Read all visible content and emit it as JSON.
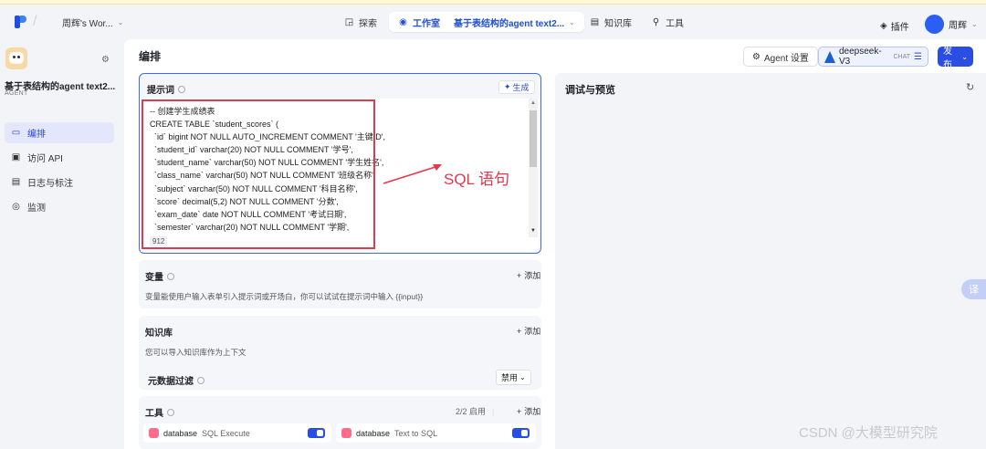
{
  "topbar": {
    "workspace": "周辉's Wor...",
    "nav": [
      {
        "icon": "compass-icon",
        "label": "探索"
      },
      {
        "icon": "robot-icon",
        "label": "工作室",
        "project": "基于表结构的agent text2..."
      },
      {
        "icon": "book-icon",
        "label": "知识库"
      },
      {
        "icon": "wrench-icon",
        "label": "工具"
      }
    ],
    "plugin": "插件",
    "user": "周辉"
  },
  "sidebar": {
    "bot_name": "基于表结构的agent text2...",
    "bot_type": "AGENT",
    "menu": [
      {
        "label": "编排",
        "icon": "layout-icon",
        "active": true
      },
      {
        "label": "访问 API",
        "icon": "terminal-icon"
      },
      {
        "label": "日志与标注",
        "icon": "log-icon"
      },
      {
        "label": "监测",
        "icon": "monitor-icon"
      }
    ]
  },
  "main": {
    "title": "编排",
    "agent_settings": "Agent 设置",
    "model": "deepseek-V3",
    "model_tag": "CHAT",
    "publish": "发布"
  },
  "prompt": {
    "label": "提示词",
    "generate": "生成",
    "lines": [
      "-- 创建学生成绩表",
      "CREATE TABLE `student_scores` (",
      "  `id` bigint NOT NULL AUTO_INCREMENT COMMENT '主键ID',",
      "  `student_id` varchar(20) NOT NULL COMMENT '学号',",
      "  `student_name` varchar(50) NOT NULL COMMENT '学生姓名',",
      "  `class_name` varchar(50) NOT NULL COMMENT '班级名称',",
      "  `subject` varchar(50) NOT NULL COMMENT '科目名称',",
      "  `score` decimal(5,2) NOT NULL COMMENT '分数',",
      "  `exam_date` date NOT NULL COMMENT '考试日期',",
      "  `semester` varchar(20) NOT NULL COMMENT '学期',"
    ],
    "char_count": "912",
    "annotation": "SQL 语句"
  },
  "variables": {
    "title": "变量",
    "add": "添加",
    "desc": "变量能使用户输入表单引入提示词或开场白，你可以试试在提示词中输入 {{input}}"
  },
  "knowledge": {
    "title": "知识库",
    "add": "添加",
    "desc": "您可以导入知识库作为上下文",
    "metadata_filter": "元数据过滤",
    "filter_value": "禁用"
  },
  "tools": {
    "title": "工具",
    "enabled": "2/2 启用",
    "add": "添加",
    "items": [
      {
        "name": "database",
        "func": "SQL Execute",
        "enabled": true
      },
      {
        "name": "database",
        "func": "Text to SQL",
        "enabled": true
      }
    ]
  },
  "preview": {
    "title": "调试与预览"
  },
  "float_translate": "译",
  "watermark": "CSDN @大模型研究院",
  "colors": {
    "accent": "#2a4de3",
    "annotation": "#e5364c"
  }
}
